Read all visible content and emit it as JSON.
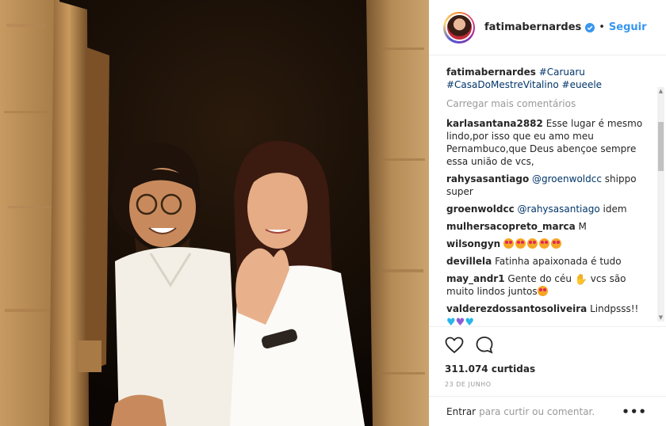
{
  "post": {
    "username": "fatimabernardes",
    "verified": true,
    "follow_label": "Seguir",
    "separator": "•"
  },
  "caption": {
    "username": "fatimabernardes",
    "tags": [
      "#Caruaru",
      "#CasaDoMestreVitalino",
      "#eueele"
    ]
  },
  "load_more_label": "Carregar mais comentários",
  "comments": [
    {
      "user": "karlasantana2882",
      "text": "Esse lugar é mesmo lindo,por isso que eu amo meu Pernambuco,que Deus abençoe sempre essa união de vcs,"
    },
    {
      "user": "rahysasantiago",
      "mention": "@groenwoldcc",
      "text": "shippo super"
    },
    {
      "user": "groenwoldcc",
      "mention": "@rahysasantiago",
      "text": "idem"
    },
    {
      "user": "mulhersacopreto_marca",
      "text": "M"
    },
    {
      "user": "wilsongyn",
      "text": "",
      "emoji_count": 5
    },
    {
      "user": "devillela",
      "text": "Fatinha apaixonada é tudo"
    },
    {
      "user": "may_andr1",
      "text_before": "Gente do céu",
      "text_after": "vcs são muito lindos juntos"
    },
    {
      "user": "valderezdossantosoliveira",
      "text": "Lindpsss!!"
    }
  ],
  "likes": "311.074 curtidas",
  "date": "23 DE JUNHO",
  "comment_input": {
    "enter": "Entrar",
    "rest": "para curtir ou comentar."
  },
  "icons": {
    "like": "heart-outline-icon",
    "comment": "speech-bubble-icon",
    "options": "more-options-icon",
    "verified": "verified-badge-icon"
  },
  "colors": {
    "link": "#3897f0",
    "hashtag": "#003569",
    "muted": "#999999"
  }
}
